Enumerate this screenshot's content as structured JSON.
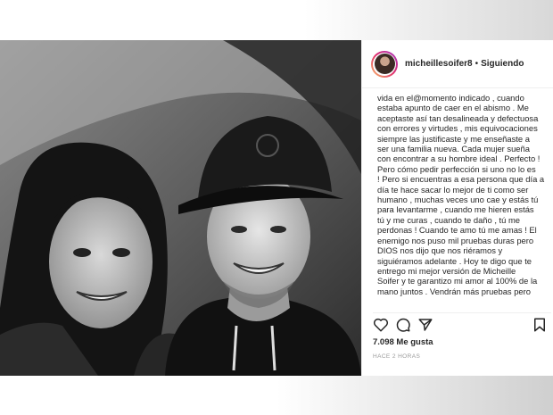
{
  "header": {
    "username": "micheillesoifer8",
    "separator": "•",
    "follow_status": "Siguiendo"
  },
  "caption_lines": [
    "vida en el@momento indicado , cuando",
    "estaba apunto de caer en el abismo . Me",
    "aceptaste así tan desalineada y defectuosa",
    "con errores y virtudes , mis equivocaciones",
    "siempre las justificaste y me enseñaste a",
    "ser una familia nueva. Cada mujer sueña",
    "con encontrar a su hombre ideal . Perfecto !",
    "Pero cómo pedir perfección si uno no lo es",
    "! Pero si encuentras a esa persona que día a",
    "día te hace sacar lo mejor de ti como ser",
    "humano , muchas veces uno cae y estás tú",
    "para levantarme , cuando me hieren estás",
    "tú y me curas , cuando te daño , tú me",
    "perdonas ! Cuando te amo tú me amas ! El",
    "enemigo nos puso mil pruebas duras pero",
    "DIOS nos dijo que nos riéramos y",
    "siguiéramos adelante . Hoy te digo que te",
    "entrego mi mejor versión de Micheille",
    "Soifer y te garantizo mi amor al 100% de la",
    "mano juntos . Vendrán más pruebas pero"
  ],
  "likes_text": "7.098 Me gusta",
  "timestamp": "HACE 2 HORAS",
  "icons": {
    "like": "heart-icon",
    "comment": "comment-icon",
    "share": "share-icon",
    "save": "bookmark-icon"
  }
}
